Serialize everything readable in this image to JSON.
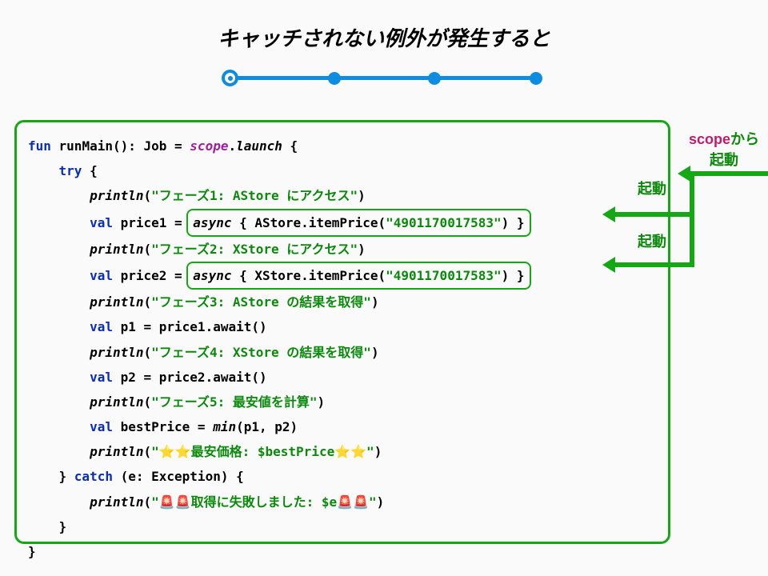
{
  "title": "キャッチされない例外が発生すると",
  "timeline": {
    "nodes": 4
  },
  "annotations": {
    "scope_launch": {
      "line1_prefix": "scope",
      "line1_suffix": "から",
      "line2": "起動"
    },
    "launch1": "起動",
    "launch2": "起動"
  },
  "code": {
    "l1_kw1": "fun",
    "l1_fn": " runMain(): Job = ",
    "l1_scope": "scope",
    "l1_dot": ".",
    "l1_launch": "launch",
    "l1_brace": " {",
    "l2_kw": "try",
    "l2_brace": " {",
    "l3_call": "println",
    "l3_paren_o": "(",
    "l3_str": "\"フェーズ1: AStore にアクセス\"",
    "l3_paren_c": ")",
    "l4_kw": "val",
    "l4_var": " price1 = ",
    "l4_async": "async",
    "l4_body": " { AStore.itemPrice(",
    "l4_str": "\"4901170017583\"",
    "l4_end": ") }",
    "l5_call": "println",
    "l5_paren_o": "(",
    "l5_str": "\"フェーズ2: XStore にアクセス\"",
    "l5_paren_c": ")",
    "l6_kw": "val",
    "l6_var": " price2 = ",
    "l6_async": "async",
    "l6_body": " { XStore.itemPrice(",
    "l6_str": "\"4901170017583\"",
    "l6_end": ") }",
    "l7_call": "println",
    "l7_paren_o": "(",
    "l7_str": "\"フェーズ3: AStore の結果を取得\"",
    "l7_paren_c": ")",
    "l8_kw": "val",
    "l8_rest": " p1 = price1.await()",
    "l9_call": "println",
    "l9_paren_o": "(",
    "l9_str": "\"フェーズ4: XStore の結果を取得\"",
    "l9_paren_c": ")",
    "l10_kw": "val",
    "l10_rest": " p2 = price2.await()",
    "l11_call": "println",
    "l11_paren_o": "(",
    "l11_str": "\"フェーズ5: 最安値を計算\"",
    "l11_paren_c": ")",
    "l12_kw": "val",
    "l12_var": " bestPrice = ",
    "l12_min": "min",
    "l12_args": "(p1, p2)",
    "l13_call": "println",
    "l13_paren_o": "(",
    "l13_str": "\"⭐⭐最安価格: $bestPrice⭐⭐\"",
    "l13_paren_c": ")",
    "l14_close": "} ",
    "l14_kw": "catch",
    "l14_args": " (e: Exception) {",
    "l15_call": "println",
    "l15_paren_o": "(",
    "l15_str": "\"🚨🚨取得に失敗しました: $e🚨🚨\"",
    "l15_paren_c": ")",
    "l16": "}",
    "l17": "}"
  }
}
